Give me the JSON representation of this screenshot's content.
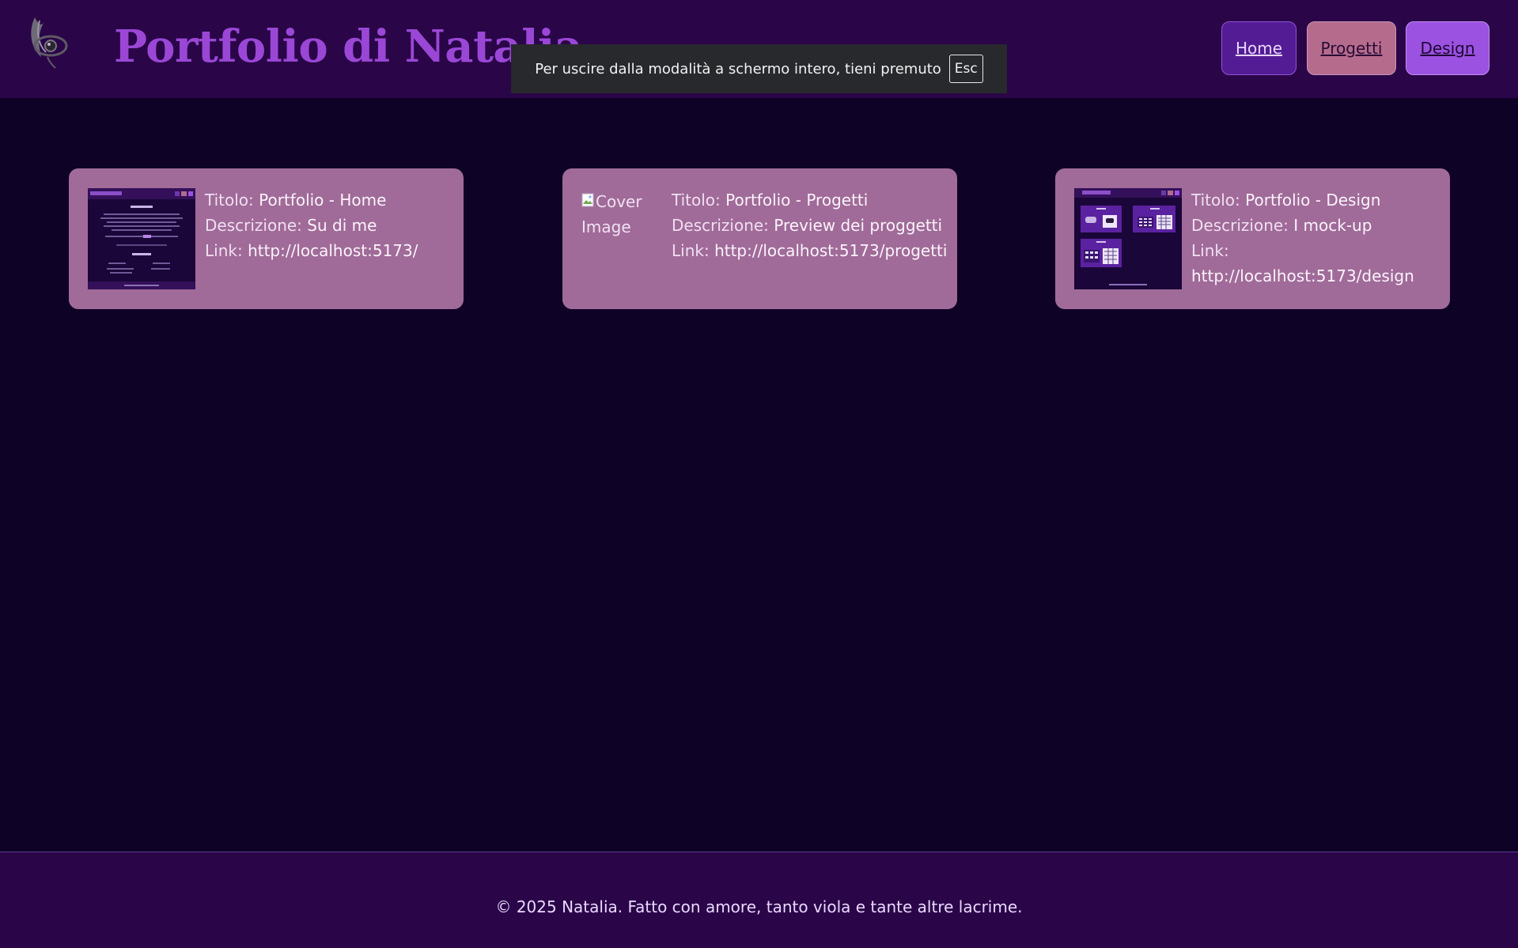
{
  "header": {
    "site_title": "Portfolio di Natalia",
    "logo_icon": "eye-feather-logo",
    "nav": [
      {
        "label": "Home"
      },
      {
        "label": "Progetti"
      },
      {
        "label": "Design"
      }
    ]
  },
  "fullscreen_notice": {
    "text": "Per uscire dalla modalità a schermo intero, tieni premuto",
    "key": "Esc"
  },
  "cards": [
    {
      "image": "home-page-screenshot",
      "title_label": "Titolo:",
      "title": "Portfolio - Home",
      "desc_label": "Descrizione:",
      "desc": "Su di me",
      "link_label": "Link:",
      "link": "http://localhost:5173/"
    },
    {
      "image_alt": "Cover Image",
      "title_label": "Titolo:",
      "title": "Portfolio - Progetti",
      "desc_label": "Descrizione:",
      "desc": "Preview dei proggetti",
      "link_label": "Link:",
      "link": "http://localhost:5173/progetti"
    },
    {
      "image": "design-page-screenshot",
      "title_label": "Titolo:",
      "title": "Portfolio - Design",
      "desc_label": "Descrizione:",
      "desc": "I mock-up",
      "link_label": "Link:",
      "link": "http://localhost:5173/design"
    }
  ],
  "footer": {
    "text": "© 2025 Natalia. Fatto con amore, tanto viola e tante altre lacrime."
  },
  "colors": {
    "page_bg": "#0e0226",
    "header_bg": "#2a0548",
    "title": "#9a47d6",
    "card_bg": "#a06b98",
    "nav_home": "#541c94",
    "nav_progetti": "#b56c8c",
    "nav_design": "#9b52e0"
  }
}
